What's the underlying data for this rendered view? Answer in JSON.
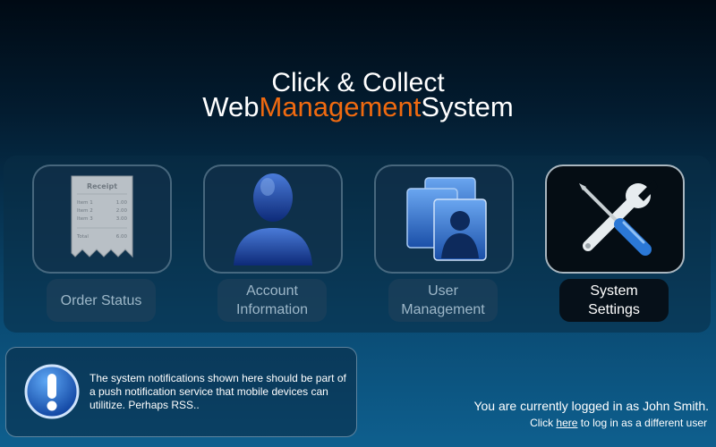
{
  "header": {
    "title_line1": "Click & Collect",
    "title_line2_part1": "Web",
    "title_line2_accent": "Management",
    "title_line2_part2": "System",
    "accent_color": "#f06a10"
  },
  "menu": {
    "items": [
      {
        "label": "Order Status",
        "icon": "receipt-icon",
        "active": false
      },
      {
        "label": "Account Information",
        "icon": "user-silhouette-icon",
        "active": false
      },
      {
        "label": "User Management",
        "icon": "users-group-icon",
        "active": false
      },
      {
        "label": "System Settings",
        "icon": "wrench-screwdriver-icon",
        "active": true
      }
    ],
    "receipt": {
      "heading": "Receipt",
      "lines": [
        {
          "name": "Item 1",
          "amount": "1.00"
        },
        {
          "name": "Item 2",
          "amount": "2.00"
        },
        {
          "name": "Item 3",
          "amount": "3.00"
        }
      ],
      "total_label": "Total",
      "total_amount": "6.00"
    }
  },
  "notification": {
    "icon": "info-icon",
    "text": "The system notifications shown here should be part of a push notification service that mobile devices can utilitize. Perhaps RSS.."
  },
  "session": {
    "logged_in_text": "You are currently logged in as John Smith.",
    "switch_prefix": "Click ",
    "switch_link": "here",
    "switch_suffix": " to log in as a different user"
  }
}
